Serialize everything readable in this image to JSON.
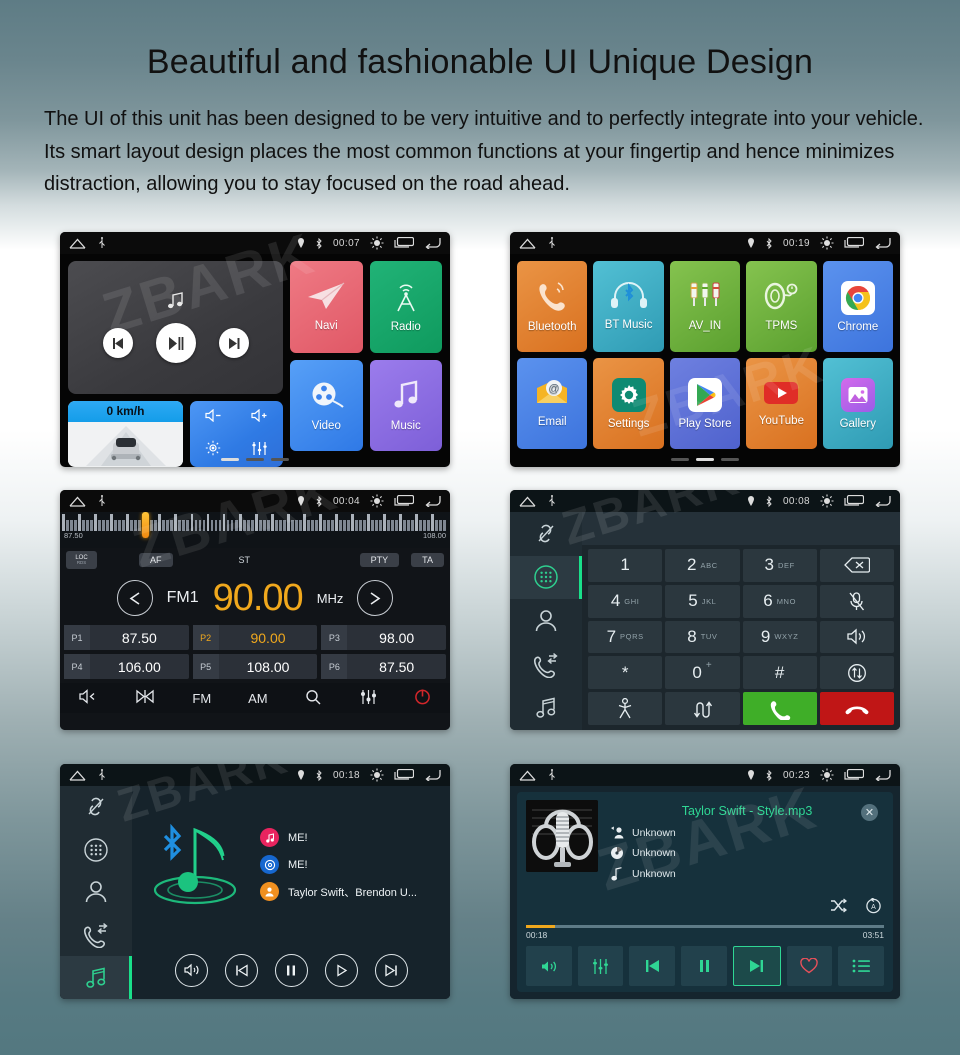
{
  "header": {
    "title": "Beautiful and fashionable UI Unique Design",
    "p1": "The UI of this unit has been designed to be very intuitive and to perfectly integrate into your vehicle.",
    "p2": "Its smart layout design places the most common functions at your fingertip and hence minimizes",
    "p3": "distraction, allowing you to stay focused on the road ahead."
  },
  "watermark": "ZBARK",
  "screens": {
    "home": {
      "clock": "00:07",
      "speed": "0 km/h",
      "tiles": [
        {
          "label": "Navi",
          "color": "#e8626f",
          "icon": "paper-plane-icon"
        },
        {
          "label": "Radio",
          "color": "#18a86b",
          "icon": "radio-tower-icon"
        },
        {
          "label": "Video",
          "color": "#3d8af0",
          "icon": "film-reel-icon"
        },
        {
          "label": "Music",
          "color": "#8a6ede",
          "icon": "music-note-icon"
        }
      ],
      "quick": [
        "volume-down-icon",
        "volume-up-icon",
        "brightness-icon",
        "equalizer-icon"
      ]
    },
    "apps": {
      "clock": "00:19",
      "items": [
        {
          "label": "Bluetooth",
          "color": "#e3812c",
          "icon": "phone-handset-icon"
        },
        {
          "label": "BT Music",
          "color": "#3fb0c8",
          "icon": "bt-headphones-icon"
        },
        {
          "label": "AV_IN",
          "color": "#6cb33f",
          "icon": "rca-plugs-icon"
        },
        {
          "label": "TPMS",
          "color": "#6cb33f",
          "icon": "tire-gauge-icon"
        },
        {
          "label": "Chrome",
          "color": "#4b85e8",
          "icon": "chrome-icon"
        },
        {
          "label": "Email",
          "color": "#4b85e8",
          "icon": "email-icon"
        },
        {
          "label": "Settings",
          "color": "#e3812c",
          "icon": "gear-icon"
        },
        {
          "label": "Play Store",
          "color": "#5f73d8",
          "icon": "play-store-icon"
        },
        {
          "label": "YouTube",
          "color": "#e3812c",
          "icon": "youtube-icon"
        },
        {
          "label": "Gallery",
          "color": "#3fb0c8",
          "icon": "gallery-icon"
        }
      ]
    },
    "radio": {
      "clock": "00:04",
      "range_min": "87.50",
      "range_max": "108.00",
      "loc_label": "LOC",
      "af": "AF",
      "st": "ST",
      "pty": "PTY",
      "ta": "TA",
      "band": "FM1",
      "frequency": "90.00",
      "unit": "MHz",
      "presets": [
        {
          "n": "P1",
          "v": "87.50",
          "active": false
        },
        {
          "n": "P2",
          "v": "90.00",
          "active": true
        },
        {
          "n": "P3",
          "v": "98.00",
          "active": false
        },
        {
          "n": "P4",
          "v": "106.00",
          "active": false
        },
        {
          "n": "P5",
          "v": "108.00",
          "active": false
        },
        {
          "n": "P6",
          "v": "87.50",
          "active": false
        }
      ],
      "bottom": [
        "mute-icon",
        "scan-icon",
        "FM",
        "AM",
        "search-icon",
        "equalizer-icon",
        "power-icon"
      ]
    },
    "dialer": {
      "clock": "00:08",
      "sidebar": [
        "bt-link-icon",
        "keypad-icon",
        "contacts-icon",
        "call-log-icon",
        "bt-music-icon"
      ],
      "keys": [
        {
          "d": "1",
          "s": ""
        },
        {
          "d": "2",
          "s": "ABC"
        },
        {
          "d": "3",
          "s": "DEF"
        },
        {
          "d": "",
          "s": "",
          "icon": "backspace-icon"
        },
        {
          "d": "4",
          "s": "GHI"
        },
        {
          "d": "5",
          "s": "JKL"
        },
        {
          "d": "6",
          "s": "MNO"
        },
        {
          "d": "",
          "s": "",
          "icon": "mic-mute-icon"
        },
        {
          "d": "7",
          "s": "PQRS"
        },
        {
          "d": "8",
          "s": "TUV"
        },
        {
          "d": "9",
          "s": "WXYZ"
        },
        {
          "d": "",
          "s": "",
          "icon": "speaker-icon"
        },
        {
          "d": "*",
          "s": ""
        },
        {
          "d": "0",
          "s": "+"
        },
        {
          "d": "#",
          "s": ""
        },
        {
          "d": "",
          "s": "",
          "icon": "transfer-icon"
        },
        {
          "d": "",
          "s": "",
          "icon": "conference-icon"
        },
        {
          "d": "",
          "s": "",
          "icon": "switch-icon"
        },
        {
          "d": "",
          "s": "",
          "icon": "call-answer-icon",
          "style": "green"
        },
        {
          "d": "",
          "s": "",
          "icon": "call-end-icon",
          "style": "red"
        }
      ]
    },
    "btmusic": {
      "clock": "00:18",
      "sidebar": [
        "bt-link-icon",
        "keypad-icon",
        "contacts-icon",
        "call-log-icon",
        "bt-music-icon"
      ],
      "tracks": [
        {
          "text": "ME!",
          "dot": "#e8245f",
          "dot_icon": "music-note-icon"
        },
        {
          "text": "ME!",
          "dot": "#1667cf",
          "dot_icon": "disc-icon"
        },
        {
          "text": "Taylor Swift、Brendon U...",
          "dot": "#f09020",
          "dot_icon": "artist-icon"
        }
      ],
      "controls": [
        "volume-icon",
        "prev-icon",
        "pause-icon",
        "play-icon",
        "next-icon"
      ]
    },
    "music": {
      "clock": "00:23",
      "title": "Taylor Swift - Style.mp3",
      "meta": [
        {
          "text": "Unknown",
          "icon": "artist-icon"
        },
        {
          "text": "Unknown",
          "icon": "album-icon"
        },
        {
          "text": "Unknown",
          "icon": "genre-icon"
        }
      ],
      "elapsed": "00:18",
      "duration": "03:51",
      "progress_pct": 8,
      "buttons": [
        "volume-icon",
        "equalizer-icon",
        "prev-icon",
        "pause-icon",
        "next-icon",
        "favorite-icon",
        "playlist-icon"
      ],
      "selected_button_index": 4,
      "close_label": "✕",
      "shuffle_icon": "shuffle-icon",
      "repeat_icon": "repeat-all-icon"
    }
  },
  "colors": {
    "accent_orange": "#f0a81d",
    "accent_green": "#2fd694",
    "call_green": "#3fae28",
    "call_red": "#c01616"
  }
}
